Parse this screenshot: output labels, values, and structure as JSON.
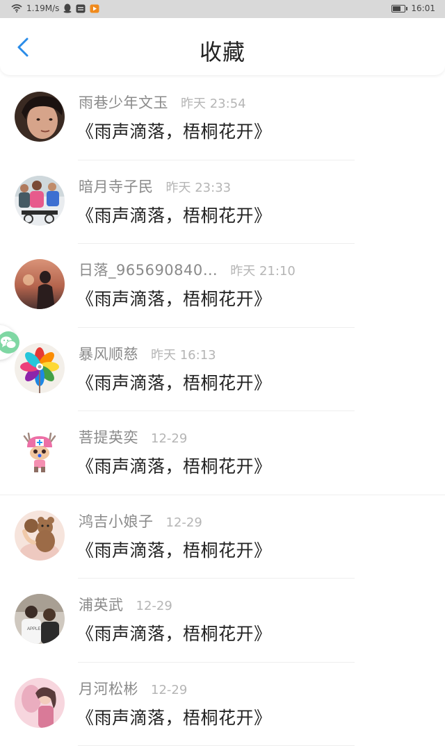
{
  "status_bar": {
    "network_speed": "1.19M/s",
    "time": "16:01",
    "icons": [
      "wifi-icon",
      "qq-icon",
      "message-icon",
      "video-app-icon",
      "battery-icon"
    ]
  },
  "header": {
    "title": "收藏",
    "back_icon": "chevron-left-icon"
  },
  "items": [
    {
      "name": "雨巷少年文玉",
      "time": "昨天 23:54",
      "title": "《雨声滴落，梧桐花开》",
      "avatar": "portrait-man"
    },
    {
      "name": "暗月寺子民",
      "time": "昨天 23:33",
      "title": "《雨声滴落，梧桐花开》",
      "avatar": "fitness-group"
    },
    {
      "name": "日落_965690840…",
      "time": "昨天 21:10",
      "title": "《雨声滴落，梧桐花开》",
      "avatar": "sunset-figure"
    },
    {
      "name": "暴风顺慈",
      "time": "昨天 16:13",
      "title": "《雨声滴落，梧桐花开》",
      "avatar": "pinwheel"
    },
    {
      "name": "菩提英奕",
      "time": "12-29",
      "title": "《雨声滴落，梧桐花开》",
      "avatar": "cartoon-reindeer"
    },
    {
      "name": "鸿吉小娘子",
      "time": "12-29",
      "title": "《雨声滴落，梧桐花开》",
      "avatar": "teddy-bear"
    },
    {
      "name": "浦英武",
      "time": "12-29",
      "title": "《雨声滴落，梧桐花开》",
      "avatar": "two-people"
    },
    {
      "name": "月河松彬",
      "time": "12-29",
      "title": "《雨声滴落，梧桐花开》",
      "avatar": "pink-figure"
    }
  ],
  "float_button": {
    "icon": "chat-bubble-icon"
  },
  "colors": {
    "accent": "#2a8ce8",
    "status_bar_bg": "#d9d9d9",
    "meta_text": "#8a8a8a",
    "time_text": "#b5b5b5",
    "chat_green": "#7fd7a3"
  }
}
